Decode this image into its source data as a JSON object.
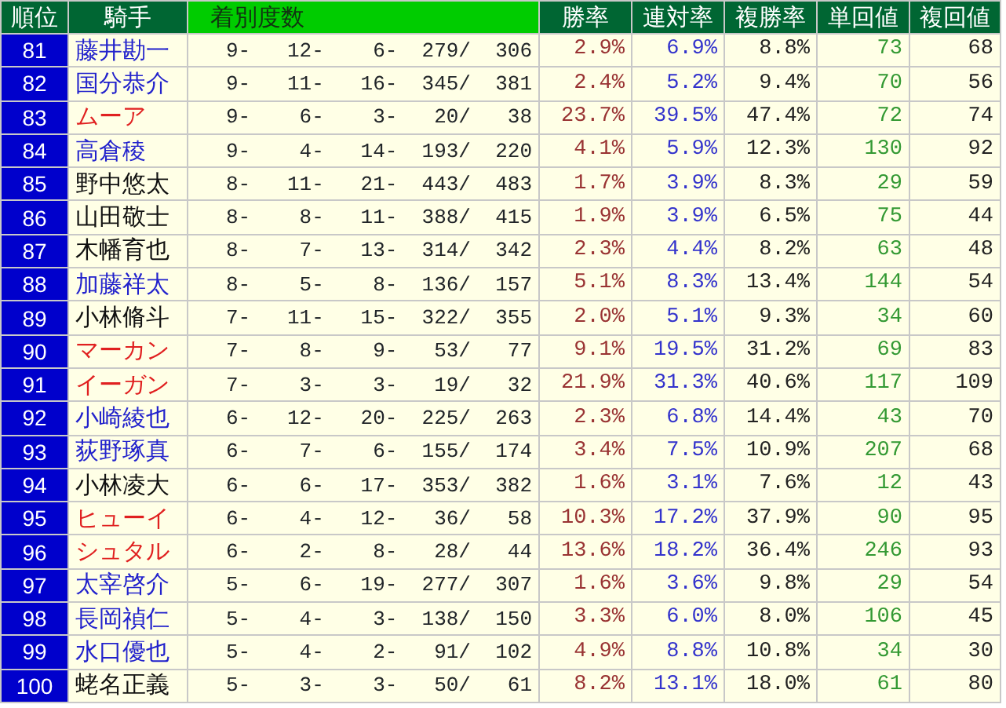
{
  "columns": [
    "順位",
    "騎手",
    "着別度数",
    "勝率",
    "連対率",
    "複勝率",
    "単回値",
    "複回値"
  ],
  "rows": [
    {
      "rank": "81",
      "jockey": "藤井勘一",
      "color": "#2222cc",
      "record": "9- 12- 6- 279/ 306",
      "win": "2.9%",
      "top2": "6.9%",
      "top3": "8.8%",
      "win_return": "73",
      "place_return": "68"
    },
    {
      "rank": "82",
      "jockey": "国分恭介",
      "color": "#2222cc",
      "record": "9- 11- 16- 345/ 381",
      "win": "2.4%",
      "top2": "5.2%",
      "top3": "9.4%",
      "win_return": "70",
      "place_return": "56"
    },
    {
      "rank": "83",
      "jockey": "ムーア",
      "color": "#e02020",
      "record": "9- 6- 3- 20/ 38",
      "win": "23.7%",
      "top2": "39.5%",
      "top3": "47.4%",
      "win_return": "72",
      "place_return": "74"
    },
    {
      "rank": "84",
      "jockey": "高倉稜",
      "color": "#2222cc",
      "record": "9- 4- 14- 193/ 220",
      "win": "4.1%",
      "top2": "5.9%",
      "top3": "12.3%",
      "win_return": "130",
      "place_return": "92"
    },
    {
      "rank": "85",
      "jockey": "野中悠太",
      "color": "#111111",
      "record": "8- 11- 21- 443/ 483",
      "win": "1.7%",
      "top2": "3.9%",
      "top3": "8.3%",
      "win_return": "29",
      "place_return": "59"
    },
    {
      "rank": "86",
      "jockey": "山田敬士",
      "color": "#111111",
      "record": "8- 8- 11- 388/ 415",
      "win": "1.9%",
      "top2": "3.9%",
      "top3": "6.5%",
      "win_return": "75",
      "place_return": "44"
    },
    {
      "rank": "87",
      "jockey": "木幡育也",
      "color": "#111111",
      "record": "8- 7- 13- 314/ 342",
      "win": "2.3%",
      "top2": "4.4%",
      "top3": "8.2%",
      "win_return": "63",
      "place_return": "48"
    },
    {
      "rank": "88",
      "jockey": "加藤祥太",
      "color": "#2222cc",
      "record": "8- 5- 8- 136/ 157",
      "win": "5.1%",
      "top2": "8.3%",
      "top3": "13.4%",
      "win_return": "144",
      "place_return": "54"
    },
    {
      "rank": "89",
      "jockey": "小林脩斗",
      "color": "#111111",
      "record": "7- 11- 15- 322/ 355",
      "win": "2.0%",
      "top2": "5.1%",
      "top3": "9.3%",
      "win_return": "34",
      "place_return": "60"
    },
    {
      "rank": "90",
      "jockey": "マーカン",
      "color": "#e02020",
      "record": "7- 8- 9- 53/ 77",
      "win": "9.1%",
      "top2": "19.5%",
      "top3": "31.2%",
      "win_return": "69",
      "place_return": "83"
    },
    {
      "rank": "91",
      "jockey": "イーガン",
      "color": "#e02020",
      "record": "7- 3- 3- 19/ 32",
      "win": "21.9%",
      "top2": "31.3%",
      "top3": "40.6%",
      "win_return": "117",
      "place_return": "109"
    },
    {
      "rank": "92",
      "jockey": "小崎綾也",
      "color": "#2222cc",
      "record": "6- 12- 20- 225/ 263",
      "win": "2.3%",
      "top2": "6.8%",
      "top3": "14.4%",
      "win_return": "43",
      "place_return": "70"
    },
    {
      "rank": "93",
      "jockey": "荻野琢真",
      "color": "#2222cc",
      "record": "6- 7- 6- 155/ 174",
      "win": "3.4%",
      "top2": "7.5%",
      "top3": "10.9%",
      "win_return": "207",
      "place_return": "68"
    },
    {
      "rank": "94",
      "jockey": "小林凌大",
      "color": "#111111",
      "record": "6- 6- 17- 353/ 382",
      "win": "1.6%",
      "top2": "3.1%",
      "top3": "7.6%",
      "win_return": "12",
      "place_return": "43"
    },
    {
      "rank": "95",
      "jockey": "ヒューイ",
      "color": "#e02020",
      "record": "6- 4- 12- 36/ 58",
      "win": "10.3%",
      "top2": "17.2%",
      "top3": "37.9%",
      "win_return": "90",
      "place_return": "95"
    },
    {
      "rank": "96",
      "jockey": "シュタル",
      "color": "#e02020",
      "record": "6- 2- 8- 28/ 44",
      "win": "13.6%",
      "top2": "18.2%",
      "top3": "36.4%",
      "win_return": "246",
      "place_return": "93"
    },
    {
      "rank": "97",
      "jockey": "太宰啓介",
      "color": "#2222cc",
      "record": "5- 6- 19- 277/ 307",
      "win": "1.6%",
      "top2": "3.6%",
      "top3": "9.8%",
      "win_return": "29",
      "place_return": "54"
    },
    {
      "rank": "98",
      "jockey": "長岡禎仁",
      "color": "#2222cc",
      "record": "5- 4- 3- 138/ 150",
      "win": "3.3%",
      "top2": "6.0%",
      "top3": "8.0%",
      "win_return": "106",
      "place_return": "45"
    },
    {
      "rank": "99",
      "jockey": "水口優也",
      "color": "#2222cc",
      "record": "5- 4- 2- 91/ 102",
      "win": "4.9%",
      "top2": "8.8%",
      "top3": "10.8%",
      "win_return": "34",
      "place_return": "30"
    },
    {
      "rank": "100",
      "jockey": "蛯名正義",
      "color": "#111111",
      "record": "5- 3- 3- 50/ 61",
      "win": "8.2%",
      "top2": "13.1%",
      "top3": "18.0%",
      "win_return": "61",
      "place_return": "80"
    }
  ]
}
